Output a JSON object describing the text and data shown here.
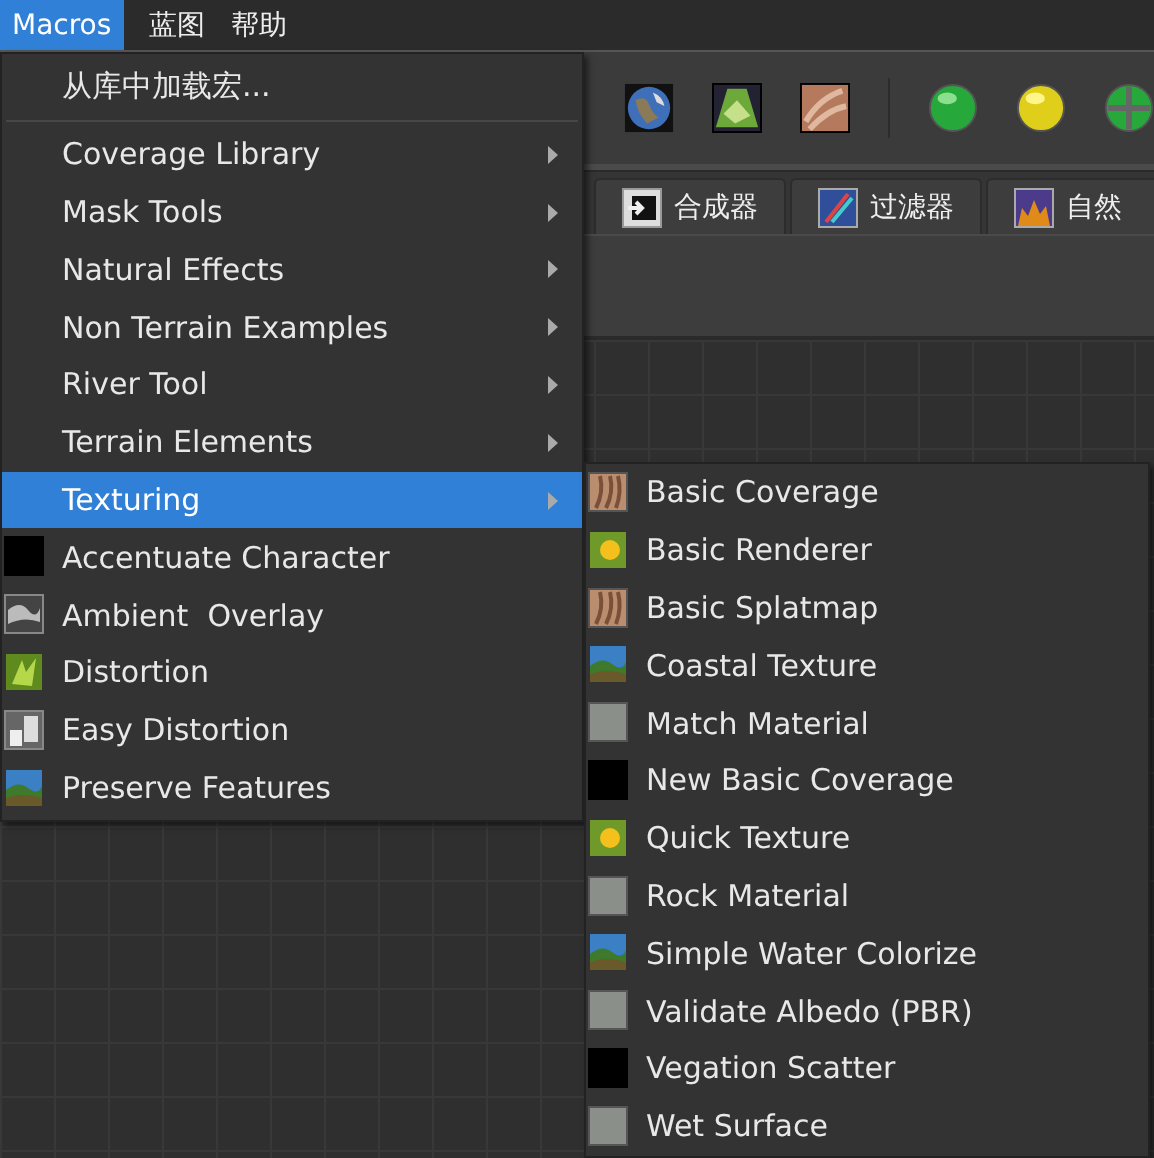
{
  "menubar": [
    {
      "label": "Macros",
      "selected": true
    },
    {
      "label": "蓝图",
      "selected": false
    },
    {
      "label": "帮助",
      "selected": false
    }
  ],
  "tabs": [
    {
      "label": "合成器"
    },
    {
      "label": "过滤器"
    },
    {
      "label": "自然"
    }
  ],
  "macros_menu": {
    "items": [
      {
        "label": "从库中加载宏...",
        "kind": "command",
        "selected": false,
        "separator_after": true
      },
      {
        "label": "Coverage Library",
        "kind": "submenu",
        "selected": false
      },
      {
        "label": "Mask Tools",
        "kind": "submenu",
        "selected": false
      },
      {
        "label": "Natural Effects",
        "kind": "submenu",
        "selected": false
      },
      {
        "label": "Non Terrain Examples",
        "kind": "submenu",
        "selected": false
      },
      {
        "label": "River Tool",
        "kind": "submenu",
        "selected": false
      },
      {
        "label": "Terrain Elements",
        "kind": "submenu",
        "selected": false
      },
      {
        "label": "Texturing",
        "kind": "submenu",
        "selected": true
      },
      {
        "label": "Accentuate Character",
        "kind": "black",
        "selected": false
      },
      {
        "label": "Ambient  Overlay",
        "kind": "cloud",
        "selected": false
      },
      {
        "label": "Distortion",
        "kind": "grass",
        "selected": false
      },
      {
        "label": "Easy Distortion",
        "kind": "blocks",
        "selected": false
      },
      {
        "label": "Preserve Features",
        "kind": "landscape",
        "selected": false
      }
    ]
  },
  "texturing_submenu": {
    "items": [
      {
        "label": "Basic Coverage",
        "kind": "rock"
      },
      {
        "label": "Basic Renderer",
        "kind": "sun"
      },
      {
        "label": "Basic Splatmap",
        "kind": "rock"
      },
      {
        "label": "Coastal Texture",
        "kind": "landscape"
      },
      {
        "label": "Match Material",
        "kind": "grey"
      },
      {
        "label": "New Basic Coverage",
        "kind": "black"
      },
      {
        "label": "Quick Texture",
        "kind": "sun"
      },
      {
        "label": "Rock Material",
        "kind": "grey"
      },
      {
        "label": "Simple Water Colorize",
        "kind": "landscape"
      },
      {
        "label": "Validate Albedo (PBR)",
        "kind": "grey"
      },
      {
        "label": "Vegation Scatter",
        "kind": "black"
      },
      {
        "label": "Wet Surface",
        "kind": "grey"
      }
    ]
  }
}
